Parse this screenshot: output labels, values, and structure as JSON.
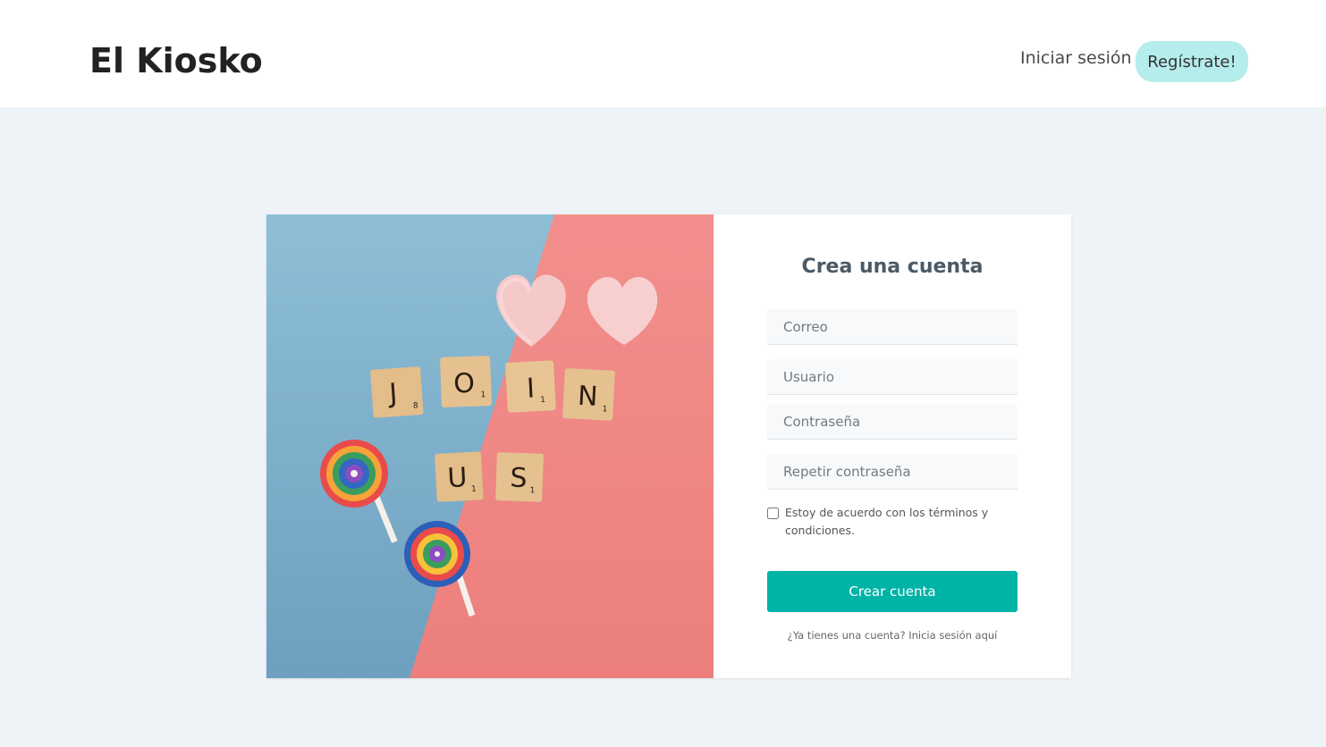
{
  "header": {
    "brand": "El Kiosko",
    "login_link": "Iniciar sesión",
    "register_button": "Regístrate!"
  },
  "hero": {
    "tiles_row1": [
      {
        "letter": "J",
        "points": "8"
      },
      {
        "letter": "O",
        "points": "1"
      },
      {
        "letter": "I",
        "points": "1"
      },
      {
        "letter": "N",
        "points": "1"
      }
    ],
    "tiles_row2": [
      {
        "letter": "U",
        "points": "1"
      },
      {
        "letter": "S",
        "points": "1"
      }
    ]
  },
  "form": {
    "title": "Crea una cuenta",
    "email_placeholder": "Correo",
    "username_placeholder": "Usuario",
    "password_placeholder": "Contraseña",
    "repeat_password_placeholder": "Repetir contraseña",
    "terms_label": "Estoy de acuerdo con los términos y condiciones.",
    "submit_label": "Crear cuenta",
    "login_prompt": "¿Ya tienes una cuenta? Inicia sesión aquí"
  },
  "colors": {
    "accent": "#00b3a7",
    "register_bg": "#b5ecec",
    "background": "#eef3f7"
  }
}
